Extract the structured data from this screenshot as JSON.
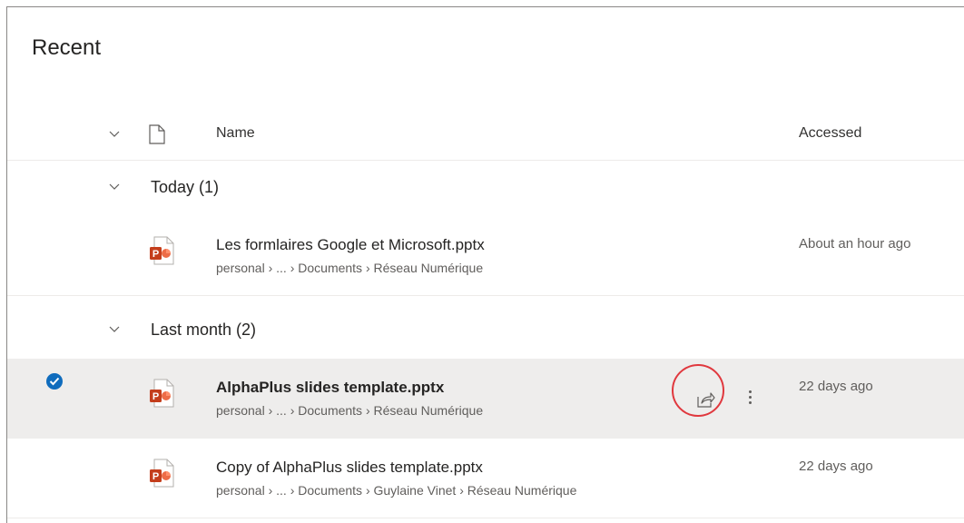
{
  "page": {
    "title": "Recent"
  },
  "header": {
    "name_label": "Name",
    "accessed_label": "Accessed"
  },
  "groups": [
    {
      "label": "Today (1)"
    },
    {
      "label": "Last month (2)"
    }
  ],
  "files": [
    {
      "name": "Les formlaires Google et Microsoft.pptx",
      "path": "personal › ... › Documents › Réseau Numérique",
      "accessed": "About an hour ago",
      "selected": false
    },
    {
      "name": "AlphaPlus slides template.pptx",
      "path": "personal › ... › Documents › Réseau Numérique",
      "accessed": "22 days ago",
      "selected": true
    },
    {
      "name": "Copy of AlphaPlus slides template.pptx",
      "path": "personal › ... › Documents › Guylaine Vinet › Réseau Numérique",
      "accessed": "22 days ago",
      "selected": false
    }
  ],
  "icons": {
    "file_type": "powerpoint-icon",
    "share": "share-icon",
    "more": "more-options-icon",
    "check": "checkmark-icon",
    "document": "document-icon",
    "chevron": "chevron-down-icon"
  },
  "colors": {
    "selection": "#0f6cbd",
    "powerpoint": "#c43e1c",
    "highlight_ring": "#e0383e",
    "selected_row": "#eeedec"
  }
}
